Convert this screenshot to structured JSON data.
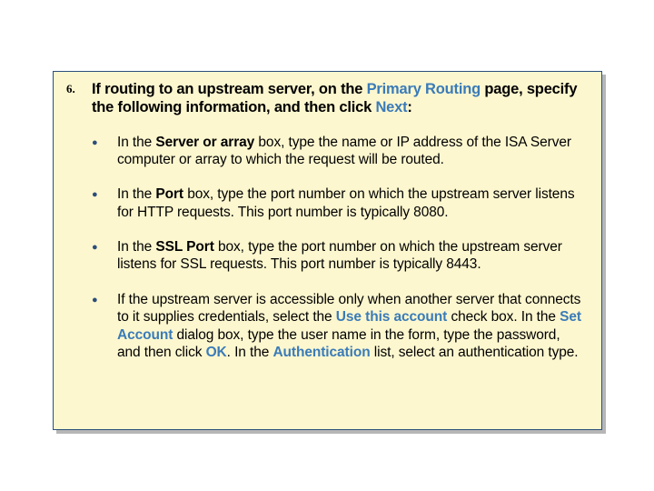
{
  "step": {
    "number": "6.",
    "lead1a": "If routing to an upstream server, on the ",
    "lead1b": "Primary Routing",
    "lead1c": " page, specify the following information, and then click ",
    "lead1d": "Next",
    "lead1e": ":"
  },
  "bullets": [
    {
      "parts": [
        {
          "t": "In the ",
          "c": ""
        },
        {
          "t": "Server or array",
          "c": "b"
        },
        {
          "t": " box, type the name or IP address of the ISA Server computer or array to which the request will be routed.",
          "c": ""
        }
      ]
    },
    {
      "parts": [
        {
          "t": "In the ",
          "c": ""
        },
        {
          "t": "Port",
          "c": "b"
        },
        {
          "t": " box, type the port number on which the upstream server listens for HTTP requests. This port number is typically 8080.",
          "c": ""
        }
      ]
    },
    {
      "parts": [
        {
          "t": "In the ",
          "c": ""
        },
        {
          "t": "SSL Port",
          "c": "b"
        },
        {
          "t": " box, type the port number on which the upstream server listens for SSL requests. This port number is typically 8443.",
          "c": ""
        }
      ]
    },
    {
      "parts": [
        {
          "t": "If the upstream server is accessible only when another server that connects to it supplies credentials, select the ",
          "c": ""
        },
        {
          "t": "Use this account",
          "c": "hl"
        },
        {
          "t": " check box. In the ",
          "c": ""
        },
        {
          "t": "Set Account",
          "c": "hl"
        },
        {
          "t": " dialog box, type the user name in the form, type the password, and then click ",
          "c": ""
        },
        {
          "t": "OK",
          "c": "hl"
        },
        {
          "t": ". In the ",
          "c": ""
        },
        {
          "t": "Authentication",
          "c": "hl"
        },
        {
          "t": " list, select an authentication type.",
          "c": ""
        }
      ]
    }
  ]
}
